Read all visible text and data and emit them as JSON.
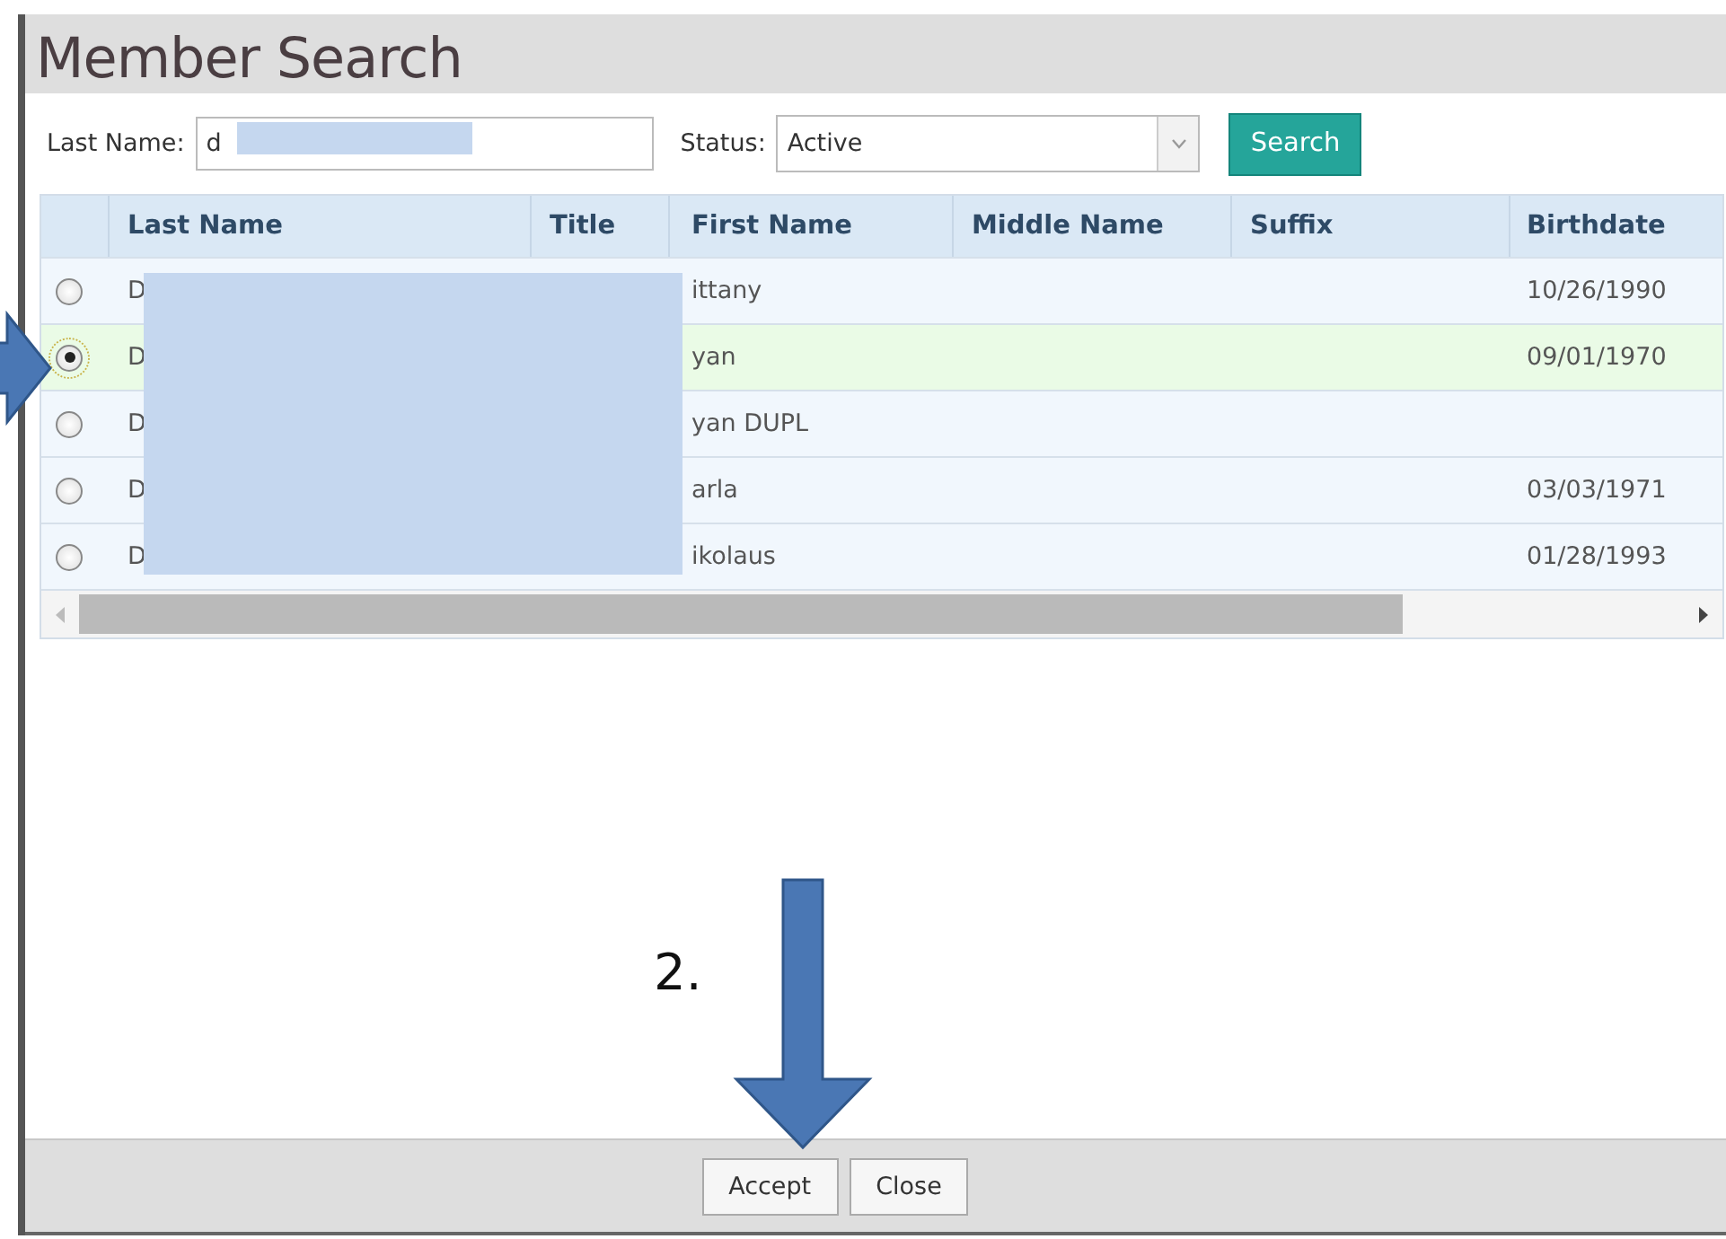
{
  "window": {
    "title": "Member Search"
  },
  "search_form": {
    "last_name": {
      "label": "Last Name:",
      "value": "d"
    },
    "status": {
      "label": "Status:",
      "value": "Active"
    },
    "search_button": "Search"
  },
  "table": {
    "columns": [
      "Last Name",
      "Title",
      "First Name",
      "Middle Name",
      "Suffix",
      "Birthdate"
    ],
    "rows": [
      {
        "selected": false,
        "last_name": "D",
        "first_name": "ittany",
        "birthdate": "10/26/1990"
      },
      {
        "selected": true,
        "last_name": "D",
        "first_name": "yan",
        "birthdate": "09/01/1970"
      },
      {
        "selected": false,
        "last_name": "D",
        "first_name": "yan DUPL"
      },
      {
        "selected": false,
        "last_name": "D",
        "first_name": "arla",
        "birthdate": "03/03/1971"
      },
      {
        "selected": false,
        "last_name": "D",
        "first_name": "ikolaus",
        "birthdate": "01/28/1993"
      }
    ]
  },
  "buttons": [
    "Accept",
    "Close"
  ],
  "annotations": [
    {
      "kind": "arrow-right"
    },
    {
      "kind": "arrow-down",
      "label": "2."
    }
  ]
}
